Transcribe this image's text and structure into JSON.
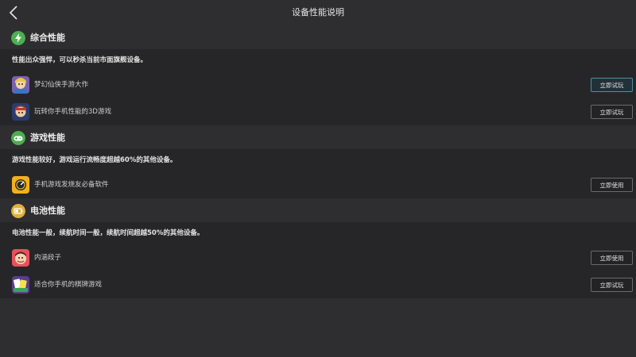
{
  "header": {
    "title": "设备性能说明",
    "back_icon": "chevron-left-icon"
  },
  "sections": [
    {
      "title": "综合性能",
      "icon": "lightning-icon",
      "icon_color": "#4caf50",
      "description": "性能出众强悍，可以秒杀当前市面旗舰设备。",
      "apps": [
        {
          "name": "梦幻仙侠手游大作",
          "button": "立即试玩"
        },
        {
          "name": "玩转你手机性能的3D游戏",
          "button": "立即试玩"
        }
      ]
    },
    {
      "title": "游戏性能",
      "icon": "gamepad-icon",
      "icon_color": "#4caf50",
      "description": "游戏性能较好，游戏运行流畅度超越60%的其他设备。",
      "apps": [
        {
          "name": "手机游戏发烧友必备软件",
          "button": "立即使用"
        }
      ]
    },
    {
      "title": "电池性能",
      "icon": "battery-icon",
      "icon_color": "#e0b23a",
      "description": "电池性能一般，续航时间一般，续航时间超越50%的其他设备。",
      "apps": [
        {
          "name": "内涵段子",
          "button": "立即使用"
        },
        {
          "name": "适合你手机的棋牌游戏",
          "button": "立即试玩"
        }
      ]
    }
  ]
}
